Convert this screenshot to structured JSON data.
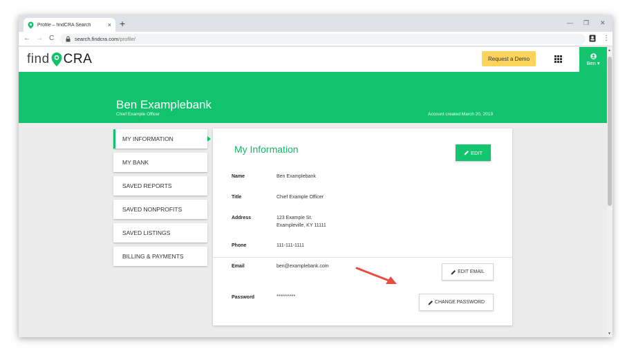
{
  "browser": {
    "tab_title": "Profile – findCRA Search",
    "tab_close": "×",
    "new_tab": "+",
    "url_host": "search.findcra.com",
    "url_path": "/profile/",
    "back": "←",
    "forward": "→",
    "reload": "C",
    "minimize": "—",
    "maximize": "❐",
    "close": "✕",
    "menu": "⋮"
  },
  "header": {
    "logo_find": "find",
    "logo_cra": "CRA",
    "request_demo": "Request a Demo",
    "user_name": "Ben",
    "user_caret": "▾"
  },
  "banner": {
    "name": "Ben Examplebank",
    "role": "Chief Example Officer",
    "created": "Account created March 20, 2019"
  },
  "sidebar": {
    "items": [
      {
        "label": "MY INFORMATION",
        "active": true
      },
      {
        "label": "MY BANK"
      },
      {
        "label": "SAVED REPORTS"
      },
      {
        "label": "SAVED NONPROFITS"
      },
      {
        "label": "SAVED LISTINGS"
      },
      {
        "label": "BILLING & PAYMENTS"
      }
    ]
  },
  "profile": {
    "title": "My Information",
    "edit_label": "EDIT",
    "name_label": "Name",
    "name_value": "Ben Examplebank",
    "title_label": "Title",
    "title_value": "Chief Example Officer",
    "address_label": "Address",
    "address_line1": "123 Example St.",
    "address_line2": "Exampleville, KY 11111",
    "phone_label": "Phone",
    "phone_value": "111-111-1111",
    "email_label": "Email",
    "email_value": "ben@examplebank.com",
    "edit_email_label": "EDIT EMAIL",
    "password_label": "Password",
    "password_value": "**********",
    "change_password_label": "CHANGE PASSWORD"
  },
  "colors": {
    "brand_green": "#12c36e",
    "demo_yellow": "#fcd35c",
    "arrow_red": "#ec4b3f"
  },
  "icons": [
    "map-pin-icon",
    "lock-icon",
    "apps-grid-icon",
    "user-icon",
    "pencil-icon",
    "chat-icon",
    "arrow-annotation"
  ]
}
